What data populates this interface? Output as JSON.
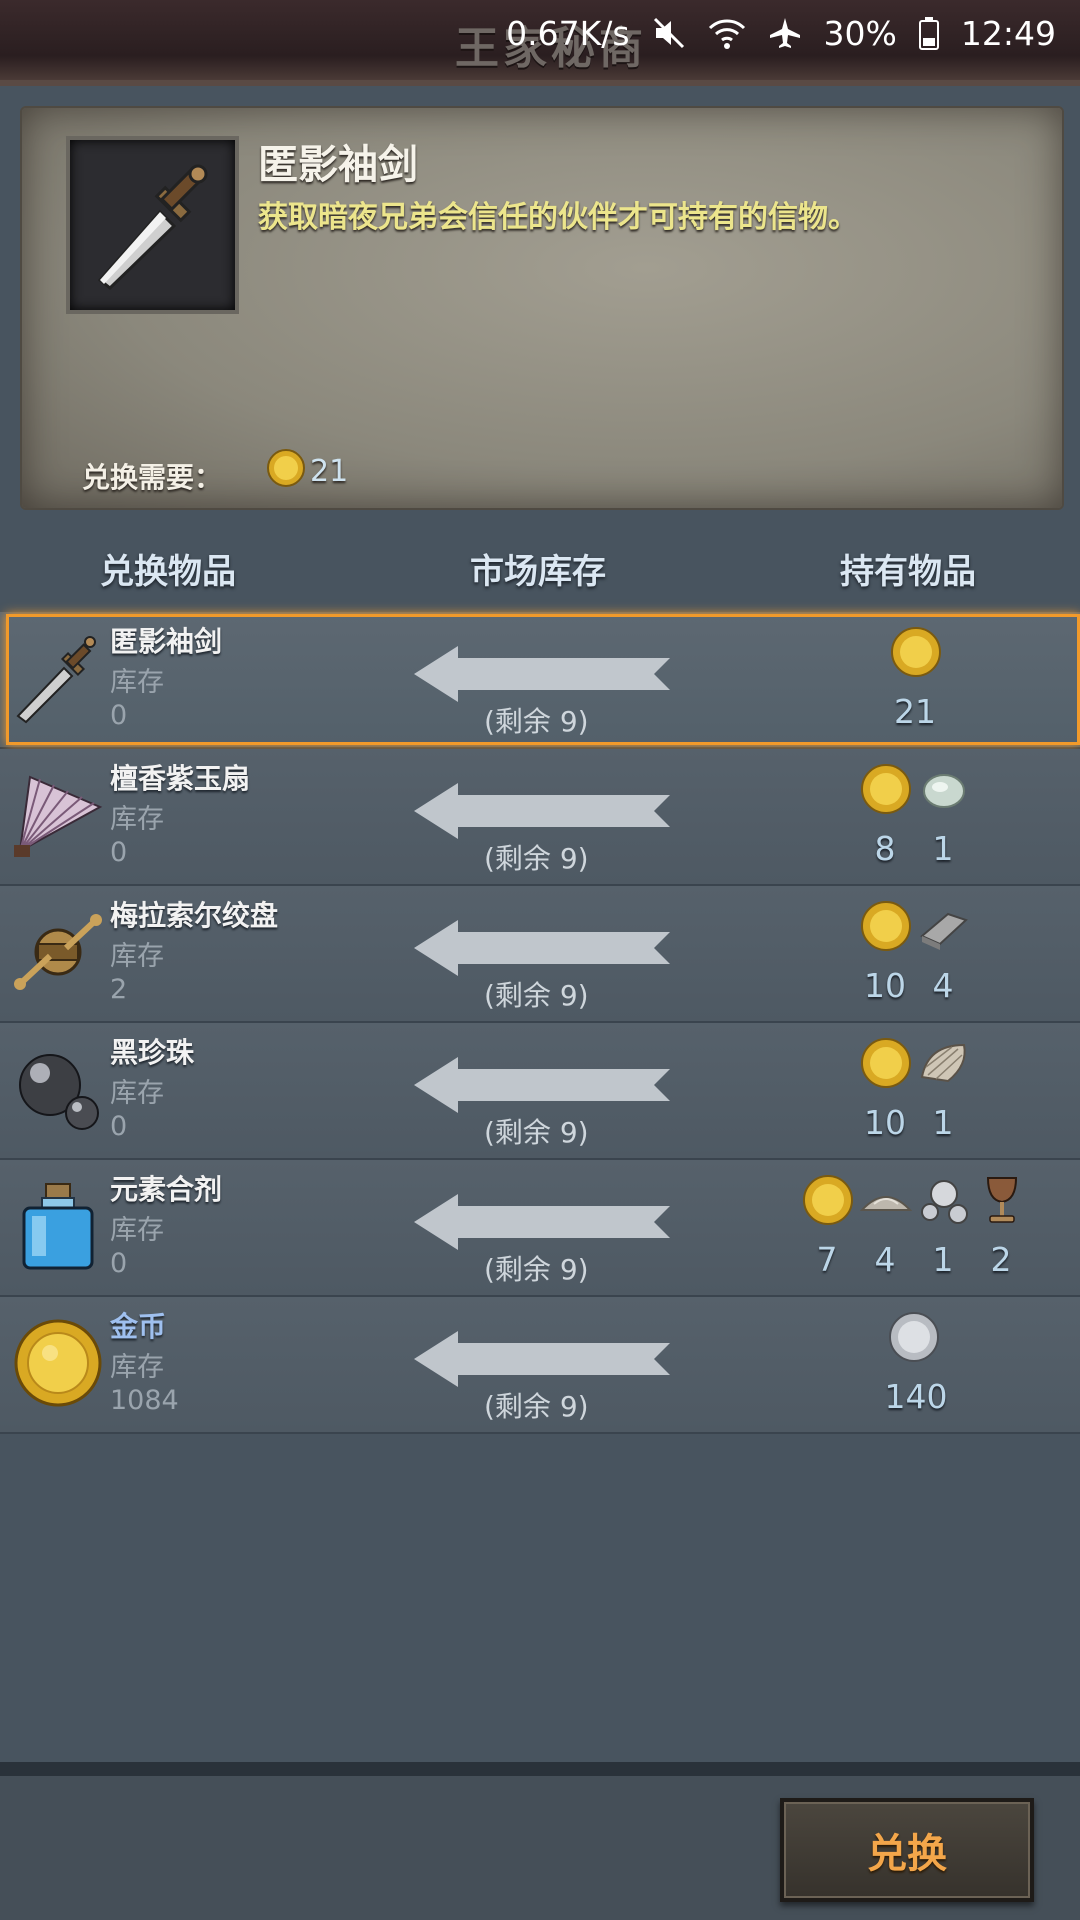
{
  "status_bar": {
    "net_speed": "0.67K/s",
    "battery": "30%",
    "time": "12:49",
    "icons": [
      "mute-icon",
      "wifi-icon",
      "airplane-icon",
      "battery-icon"
    ]
  },
  "header": {
    "title": "王家秘商"
  },
  "detail": {
    "name": "匿影袖剑",
    "description": "获取暗夜兄弟会信任的伙伴才可持有的信物。",
    "requirement_label": "兑换需要：",
    "requirement_value": "21",
    "requirement_icon": "gold-coin-icon"
  },
  "columns": {
    "item": "兑换物品",
    "stock": "市场库存",
    "owned": "持有物品"
  },
  "rows": [
    {
      "name": "匿影袖剑",
      "stock_label": "库存",
      "stock": "0",
      "remain": "(剩余 9)",
      "icon": "dagger-icon",
      "costs": [
        {
          "icon": "gold-coin-icon",
          "value": "21"
        }
      ]
    },
    {
      "name": "檀香紫玉扇",
      "stock_label": "库存",
      "stock": "0",
      "remain": "(剩余 9)",
      "icon": "fan-icon",
      "costs": [
        {
          "icon": "gold-coin-icon",
          "value": "8"
        },
        {
          "icon": "jade-stone-icon",
          "value": "1"
        }
      ]
    },
    {
      "name": "梅拉索尔绞盘",
      "stock_label": "库存",
      "stock": "2",
      "remain": "(剩余 9)",
      "icon": "winch-icon",
      "costs": [
        {
          "icon": "gold-coin-icon",
          "value": "10"
        },
        {
          "icon": "iron-ingot-icon",
          "value": "4"
        }
      ]
    },
    {
      "name": "黑珍珠",
      "stock_label": "库存",
      "stock": "0",
      "remain": "(剩余 9)",
      "icon": "black-pearl-icon",
      "costs": [
        {
          "icon": "gold-coin-icon",
          "value": "10"
        },
        {
          "icon": "oyster-shell-icon",
          "value": "1"
        }
      ]
    },
    {
      "name": "元素合剂",
      "stock_label": "库存",
      "stock": "0",
      "remain": "(剩余 9)",
      "icon": "potion-bottle-icon",
      "costs": [
        {
          "icon": "gold-coin-icon",
          "value": "7"
        },
        {
          "icon": "powder-pile-icon",
          "value": "4"
        },
        {
          "icon": "pearls-icon",
          "value": "1"
        },
        {
          "icon": "goblet-icon",
          "value": "2"
        }
      ]
    },
    {
      "name": "金币",
      "stock_label": "库存",
      "stock": "1084",
      "remain": "(剩余 9)",
      "icon": "gold-coin-large-icon",
      "costs": [
        {
          "icon": "silver-coin-icon",
          "value": "140"
        }
      ]
    }
  ],
  "footer": {
    "exchange_button": "兑换"
  },
  "colors": {
    "highlight": "#f19a2b",
    "button_text": "#f3a64a",
    "desc_text": "#ece58c"
  }
}
